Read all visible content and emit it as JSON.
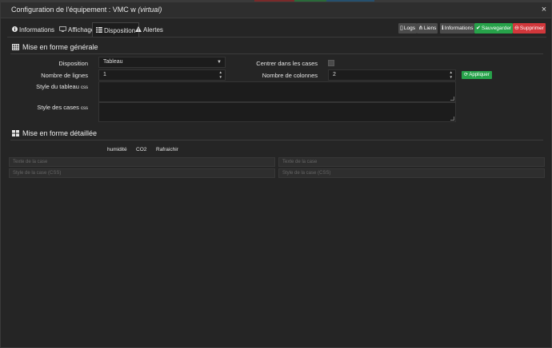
{
  "window": {
    "title_prefix": "Configuration de l'équipement : VMC w ",
    "title_virtual": "(virtual)",
    "close_symbol": "×"
  },
  "tabs": [
    {
      "label": "Informations",
      "icon": "info-circle-icon",
      "active": false
    },
    {
      "label": "Affichage",
      "icon": "monitor-icon",
      "active": false
    },
    {
      "label": "Disposition",
      "icon": "grid-list-icon",
      "active": true
    },
    {
      "label": "Alertes",
      "icon": "warning-icon",
      "active": false
    }
  ],
  "actions": {
    "logs": "Logs",
    "liens": "Liens",
    "informations": "Informations",
    "sauvegarder": "Sauvegarder",
    "supprimer": "Supprimer"
  },
  "general": {
    "heading": "Mise en forme générale",
    "disposition_label": "Disposition",
    "disposition_value": "Tableau",
    "center_label": "Centrer dans les cases",
    "rows_label": "Nombre de lignes",
    "rows_value": "1",
    "cols_label": "Nombre de colonnes",
    "cols_value": "2",
    "apply_label": "Appliquer",
    "table_style_label": "Style du tableau",
    "cell_style_label": "Style des cases",
    "css_suffix": "css"
  },
  "detailed": {
    "heading": "Mise en forme détaillée",
    "columns": [
      "humidité",
      "CO2",
      "Rafraichir"
    ],
    "cell_text_placeholder": "Texte de la case",
    "cell_style_placeholder": "Style de la case (CSS)"
  },
  "colors": {
    "accent_green": "#27a24a",
    "danger_red": "#d1373b",
    "background": "#252525"
  }
}
